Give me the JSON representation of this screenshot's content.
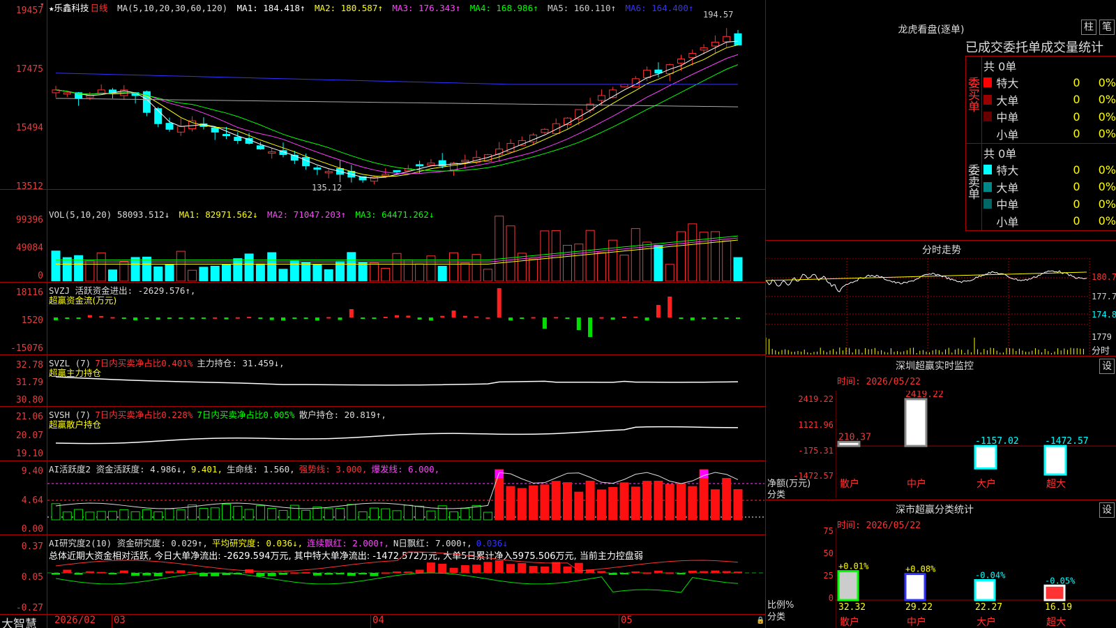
{
  "app": {
    "brand": "大智慧"
  },
  "kline": {
    "title": "★乐鑫科技",
    "period": "日线",
    "ma_spec": "MA(5,10,20,30,60,120)",
    "ma_labels": [
      "MA1: 184.418↑",
      "MA2: 180.587↑",
      "MA3: 176.343↑",
      "MA4: 168.986↑",
      "MA5: 160.110↑",
      "MA6: 164.400↑"
    ],
    "ma_colors": [
      "#ffffff",
      "#ffff00",
      "#ff40ff",
      "#00ff00",
      "#aaaaaa",
      "#3333ff"
    ],
    "yticks": [
      "19457",
      "17475",
      "15494",
      "13512"
    ],
    "high_label": "194.57",
    "low_label": "135.12"
  },
  "vol": {
    "labels": [
      "VOL(5,10,20) 58093.512↓",
      "MA1: 82971.562↓",
      "MA2: 71047.203↑",
      "MA3: 64471.262↓"
    ],
    "yticks": [
      "99396",
      "49084",
      "0"
    ]
  },
  "svzj": {
    "line1": "SVZJ  活跃资金进出: -2629.576↑,",
    "line2": "超赢资金流(万元)",
    "yticks": [
      "18116",
      "1520",
      "-15076"
    ]
  },
  "svzl": {
    "line1a": "SVZL (7)",
    "line1b": "7日内买卖净占比0.401%",
    "line1c": "主力持仓: 31.459↓,",
    "line2": "超赢主力持仓",
    "yticks": [
      "32.78",
      "31.79",
      "30.80"
    ]
  },
  "svsh": {
    "line1a": "SVSH (7)",
    "line1b": "7日内买卖净占比0.228%",
    "line1c": "7日内买卖净占比0.005%",
    "line1d": "散户持仓: 20.819↑,",
    "line2": "超赢散户持仓",
    "yticks": [
      "21.06",
      "20.07",
      "19.10"
    ]
  },
  "ai2": {
    "a": "AI活跃度2 资金活跃度: 4.986↓,",
    "b": "9.401,",
    "c": "生命线: 1.560,",
    "d": "强势线: 3.000,",
    "e": "爆发线: 6.000,",
    "yticks": [
      "9.40",
      "4.64",
      "0.00"
    ]
  },
  "ai_research": {
    "a": "AI研究度2(10) 资金研究度: 0.029↑,",
    "b": "平均研究度: 0.036↓,",
    "c": "连续飘红: 2.000↑,",
    "d": "N日飘红: 7.000↑,",
    "e": "0.036↓",
    "summary": "总体近期大资金相对活跃, 今日大单净流出: -2629.594万元, 其中特大单净流出: -1472.572万元, 大单5日累计净入5975.506万元, 当前主力控盘弱",
    "yticks": [
      "0.37",
      "0.05",
      "-0.27"
    ]
  },
  "xaxis": {
    "labels": [
      "2026/02",
      "03",
      "04",
      "05"
    ]
  },
  "lhb": {
    "title": "龙虎看盘(逐单)",
    "btn_bar": "柱",
    "btn_pen": "笔",
    "tabs": "已成交委托单成交量统计",
    "buy_title": "委买单",
    "sell_title": "委卖单",
    "total": "共 0单",
    "rows": [
      {
        "label": "特大",
        "val": "0",
        "pct": "0%"
      },
      {
        "label": "大单",
        "val": "0",
        "pct": "0%"
      },
      {
        "label": "中单",
        "val": "0",
        "pct": "0%"
      },
      {
        "label": "小单",
        "val": "0",
        "pct": "0%"
      }
    ],
    "buy_colors": [
      "#ff0000",
      "#990000",
      "#660000",
      "#000000"
    ],
    "sell_colors": [
      "#00ffff",
      "#008888",
      "#006666",
      "#000000"
    ]
  },
  "intraday": {
    "title": "分时走势",
    "yticks": [
      "180.7",
      "177.7",
      "174.8"
    ],
    "vol_tick": "1779",
    "footer": "分时"
  },
  "sz_monitor": {
    "title": "深圳超赢实时监控",
    "btn": "设",
    "time": "时间: 2026/05/22",
    "yticks": [
      "2419.22",
      "1121.96",
      "-175.31",
      "-1472.57"
    ],
    "unit1": "净额(万元)",
    "unit2": "分类",
    "values": [
      "210.37",
      "2419.22",
      "-1157.02",
      "-1472.57"
    ],
    "cats": [
      "散户",
      "中户",
      "大户",
      "超大"
    ]
  },
  "sz_class": {
    "title": "深市超赢分类统计",
    "btn": "设",
    "time": "时间: 2026/05/22",
    "yticks": [
      "75",
      "50",
      "25",
      "0"
    ],
    "unit1": "比例%",
    "unit2": "分类",
    "changes": [
      "+0.01%",
      "+0.08%",
      "-0.04%",
      "-0.05%"
    ],
    "values": [
      "32.32",
      "29.22",
      "22.27",
      "16.19"
    ],
    "cats": [
      "散户",
      "中户",
      "大户",
      "超大"
    ]
  }
}
